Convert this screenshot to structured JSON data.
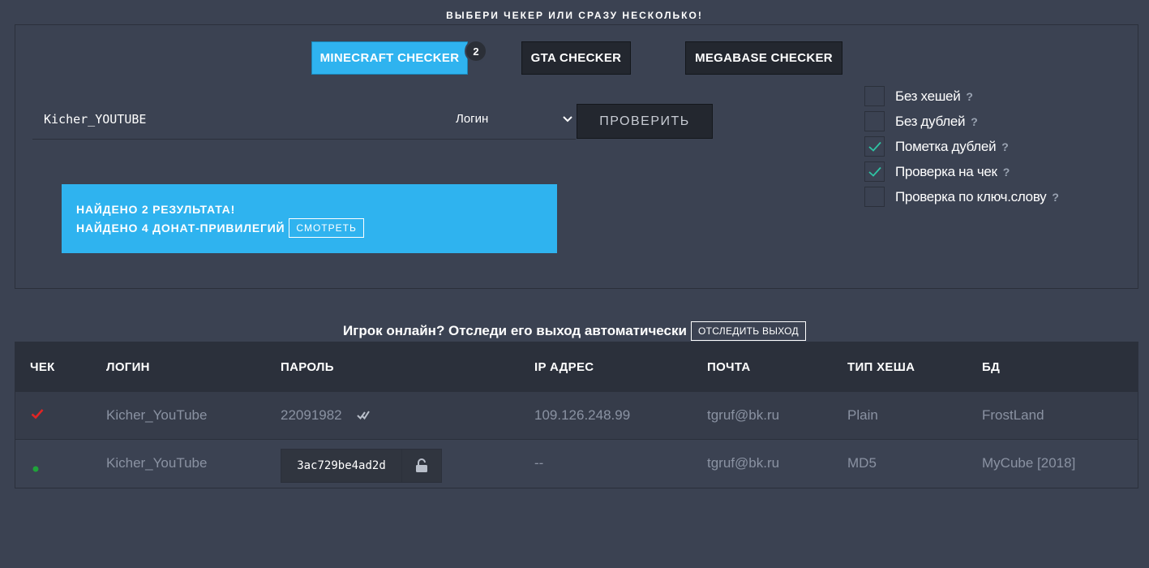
{
  "heading": "ВЫБЕРИ ЧЕКЕР ИЛИ СРАЗУ НЕСКОЛЬКО!",
  "checkers": [
    {
      "label": "MINECRAFT CHECKER",
      "active": true
    },
    {
      "label": "GTA CHECKER",
      "active": false
    },
    {
      "label": "MEGABASE CHECKER",
      "active": false
    }
  ],
  "badge": "2",
  "search": {
    "value": "Kicher_YOUTUBE",
    "type_selected": "Логин"
  },
  "check_button": "ПРОВЕРИТЬ",
  "options": [
    {
      "label": "Без хешей",
      "checked": false
    },
    {
      "label": "Без дублей",
      "checked": false
    },
    {
      "label": "Пометка дублей",
      "checked": true
    },
    {
      "label": "Проверка на чек",
      "checked": true
    },
    {
      "label": "Проверка по ключ.слову",
      "checked": false
    }
  ],
  "qmark": "?",
  "result": {
    "line1": "НАЙДЕНО 2 РЕЗУЛЬТАТА!",
    "line2": "НАЙДЕНО 4 ДОНАТ-ПРИВИЛЕГИЙ",
    "view_button": "СМОТРЕТЬ"
  },
  "track": {
    "text": "Игрок онлайн? Отследи его выход автоматически",
    "button": "ОТСЛЕДИТЬ ВЫХОД"
  },
  "table": {
    "headers": [
      "ЧЕК",
      "ЛОГИН",
      "ПАРОЛЬ",
      "IP АДРЕС",
      "ПОЧТА",
      "ТИП ХЕША",
      "БД"
    ],
    "rows": [
      {
        "check": "checkmark-red",
        "login": "Kicher_YouTube",
        "password": "22091982",
        "ip": "109.126.248.99",
        "email": "tgruf@bk.ru",
        "hash_type": "Plain",
        "db": "FrostLand"
      },
      {
        "check": "dot-green",
        "login": "Kicher_YouTube",
        "password": "3ac729be4ad2d",
        "ip": "--",
        "email": "tgruf@bk.ru",
        "hash_type": "MD5",
        "db": "MyCube [2018]"
      }
    ]
  },
  "colors": {
    "accent": "#2fb3ef",
    "background": "#3b4252",
    "dark": "#23272f",
    "check_red": "#e02424",
    "dot_green": "#1fa33a",
    "teal_check": "#2ec4a4"
  }
}
